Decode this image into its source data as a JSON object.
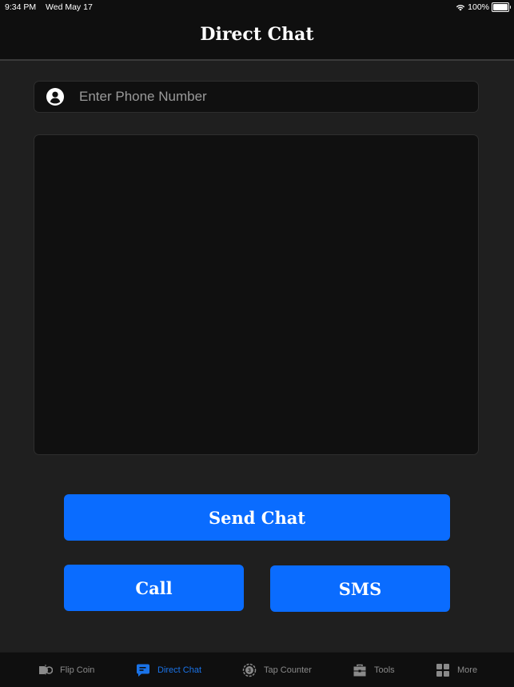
{
  "status_bar": {
    "time": "9:34 PM",
    "date": "Wed May 17",
    "battery": "100%"
  },
  "header": {
    "title": "Direct Chat"
  },
  "phone_input": {
    "placeholder": "Enter Phone Number",
    "value": "",
    "icon": "person-circle-icon"
  },
  "message_area": {
    "value": "",
    "placeholder": ""
  },
  "buttons": {
    "send_chat": "Send Chat",
    "call": "Call",
    "sms": "SMS"
  },
  "colors": {
    "accent": "#0a6cff",
    "tab_active": "#1a73e8",
    "tab_inactive": "#8a8a8a",
    "background": "#1f1f1f"
  },
  "tabs": [
    {
      "label": "Flip Coin",
      "icon": "flip-coin-icon",
      "active": false
    },
    {
      "label": "Direct Chat",
      "icon": "chat-bubble-icon",
      "active": true
    },
    {
      "label": "Tap Counter",
      "icon": "tap-counter-icon",
      "active": false
    },
    {
      "label": "Tools",
      "icon": "toolbox-icon",
      "active": false
    },
    {
      "label": "More",
      "icon": "grid-icon",
      "active": false
    }
  ]
}
